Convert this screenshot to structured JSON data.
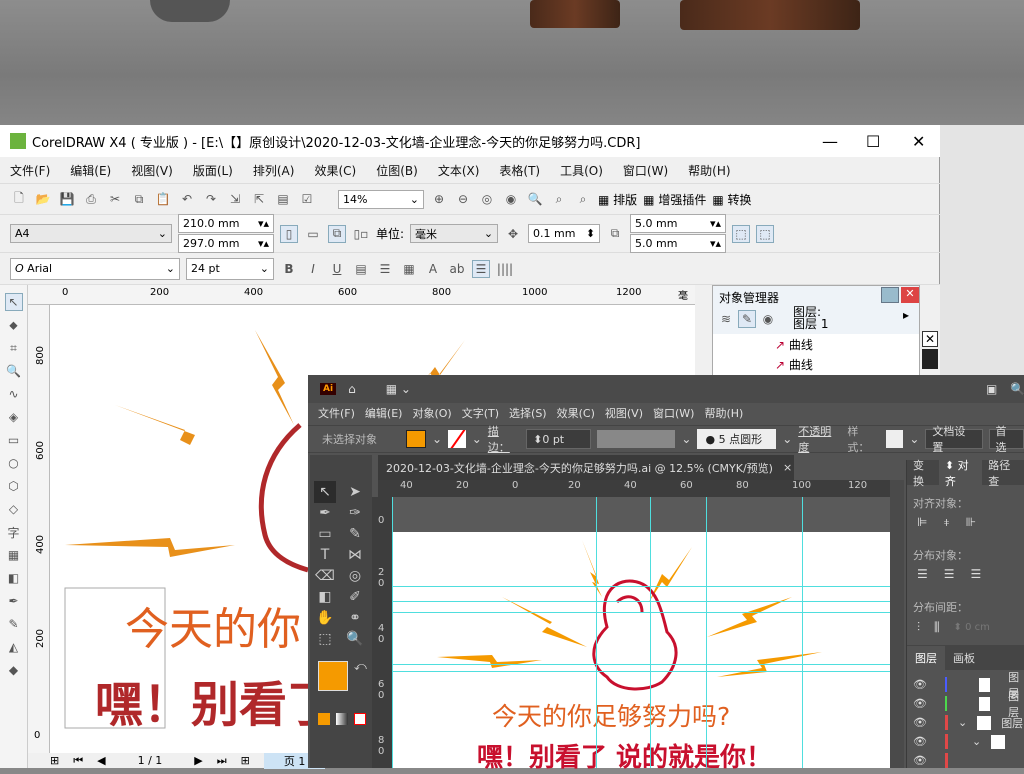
{
  "corel": {
    "title": "CorelDRAW X4 ( 专业版 ) - [E:\\【】原创设计\\2020-12-03-文化墙-企业理念-今天的你足够努力吗.CDR]",
    "menu": [
      "文件(F)",
      "编辑(E)",
      "视图(V)",
      "版面(L)",
      "排列(A)",
      "效果(C)",
      "位图(B)",
      "文本(X)",
      "表格(T)",
      "工具(O)",
      "窗口(W)",
      "帮助(H)"
    ],
    "zoom": "14%",
    "plugins": [
      "排版",
      "增强插件",
      "转换"
    ],
    "page_size": "A4",
    "width": "210.0 mm",
    "height": "297.0 mm",
    "unit_label": "单位:",
    "unit": "毫米",
    "nudge": "0.1 mm",
    "dup_x": "5.0 mm",
    "dup_y": "5.0 mm",
    "font": "Arial",
    "font_size": "24 pt",
    "ruler_h": [
      "0",
      "200",
      "400",
      "600",
      "800",
      "1000",
      "1200"
    ],
    "ruler_unit": "毫米",
    "ruler_v": [
      "800",
      "600",
      "400",
      "200",
      "0"
    ],
    "page_nav": "1 / 1",
    "page_tab": "页 1",
    "object_manager": {
      "title": "对象管理器",
      "layer_label": "图层:",
      "layer_name": "图层 1",
      "items": [
        "曲线",
        "曲线"
      ]
    },
    "art": {
      "line1": "今天的你",
      "line2": "嘿！别看了"
    }
  },
  "ai": {
    "logo": "Ai",
    "menu": [
      "文件(F)",
      "编辑(E)",
      "对象(O)",
      "文字(T)",
      "选择(S)",
      "效果(C)",
      "视图(V)",
      "窗口(W)",
      "帮助(H)"
    ],
    "control": {
      "selection": "未选择对象",
      "stroke_label": "描边：",
      "stroke": "0 pt",
      "brush": "5 点圆形",
      "opacity": "不透明度",
      "style": "样式：",
      "doc_setup": "文档设置",
      "prefs": "首选"
    },
    "fill_color": "#f59a00",
    "doc_tab": "2020-12-03-文化墙-企业理念-今天的你足够努力吗.ai @ 12.5% (CMYK/预览)",
    "ruler_h": [
      "40",
      "20",
      "0",
      "20",
      "40",
      "60",
      "80",
      "100",
      "120"
    ],
    "ruler_v": [
      "0",
      "2 0",
      "4 0",
      "6 0",
      "8 0"
    ],
    "art": {
      "line1": "今天的你足够努力吗?",
      "line2": "嘿！别看了  说的就是你！"
    },
    "panel": {
      "tabs": [
        "变换",
        "对齐",
        "路径查"
      ],
      "align_objects": "对齐对象：",
      "distribute_objects": "分布对象：",
      "distribute_spacing": "分布间距：",
      "spacing_value": "0 cm",
      "layer_tabs": [
        "图层",
        "画板"
      ],
      "layers": [
        "图层",
        "图层",
        "图层"
      ],
      "layer_colors": [
        "#4a5cff",
        "#4cd84c",
        "#e04848"
      ]
    }
  },
  "colors": {
    "orange": "#e8901a",
    "red": "#b0282a",
    "text_orange": "#e06020"
  }
}
